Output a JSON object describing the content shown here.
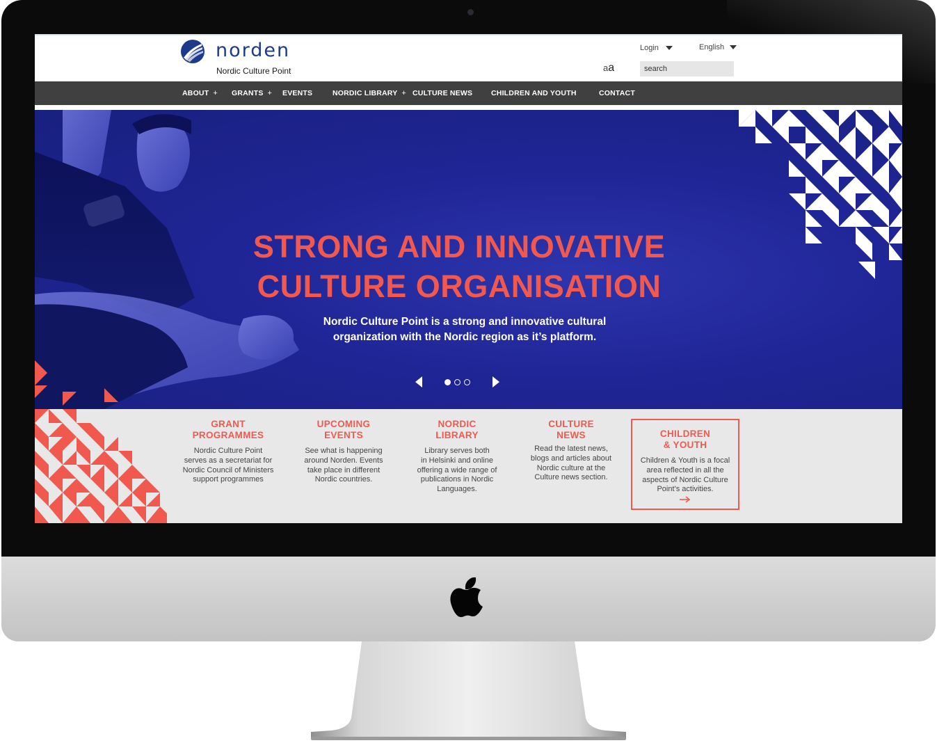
{
  "brand": {
    "name": "norden",
    "subtitle": "Nordic Culture Point"
  },
  "utility": {
    "login_label": "Login",
    "language_label": "English",
    "font_small": "a",
    "font_large": "a",
    "search_placeholder": "search"
  },
  "nav": {
    "items": [
      {
        "label": "ABOUT",
        "has_submenu": true
      },
      {
        "label": "GRANTS",
        "has_submenu": true
      },
      {
        "label": "EVENTS",
        "has_submenu": false
      },
      {
        "label": "NORDIC LIBRARY",
        "has_submenu": true
      },
      {
        "label": "CULTURE NEWS",
        "has_submenu": false
      },
      {
        "label": "CHILDREN AND YOUTH",
        "has_submenu": false
      },
      {
        "label": "CONTACT",
        "has_submenu": false
      }
    ],
    "submenu_symbol": "+"
  },
  "hero": {
    "title_line1": "STRONG AND INNOVATIVE",
    "title_line2": "CULTURE ORGANISATION",
    "sub_line1": "Nordic Culture Point is a strong and innovative cultural",
    "sub_line2": "organization with the Nordic region as it’s platform.",
    "slides_total": 3,
    "active_slide": 1
  },
  "cards": [
    {
      "title": "GRANT\nPROGRAMMES",
      "text": "Nordic Culture Point\nserves as a secretariat for\nNordic Council of Ministers\nsupport programmes"
    },
    {
      "title": "UPCOMING\nEVENTS",
      "text": "See what is happening\naround Norden. Events\ntake place in different\nNordic countries."
    },
    {
      "title": "NORDIC\nLIBRARY",
      "text": "Library serves both\nin Helsinki and online\noffering a wide range of\npublications in Nordic\nLanguages."
    },
    {
      "title": "CULTURE\nNEWS",
      "text": "Read the latest news,\nblogs and articles about\nNordic culture at the\nCulture news section."
    },
    {
      "title": "CHILDREN\n& YOUTH",
      "text": "Children & Youth is a focal\narea reflected in all the\naspects of Nordic Culture\nPoint’s activities."
    }
  ],
  "colors": {
    "accent": "#f2594e",
    "brand_blue": "#1e3a8a",
    "hero_blue": "#1f2595",
    "nav_bg": "#404040",
    "strip_bg": "#e8e8e8"
  },
  "icons": [
    "norden-logo-icon",
    "caret-down-icon",
    "arrow-left-icon",
    "arrow-right-icon",
    "arrow-right-small-icon",
    "apple-logo-icon"
  ]
}
